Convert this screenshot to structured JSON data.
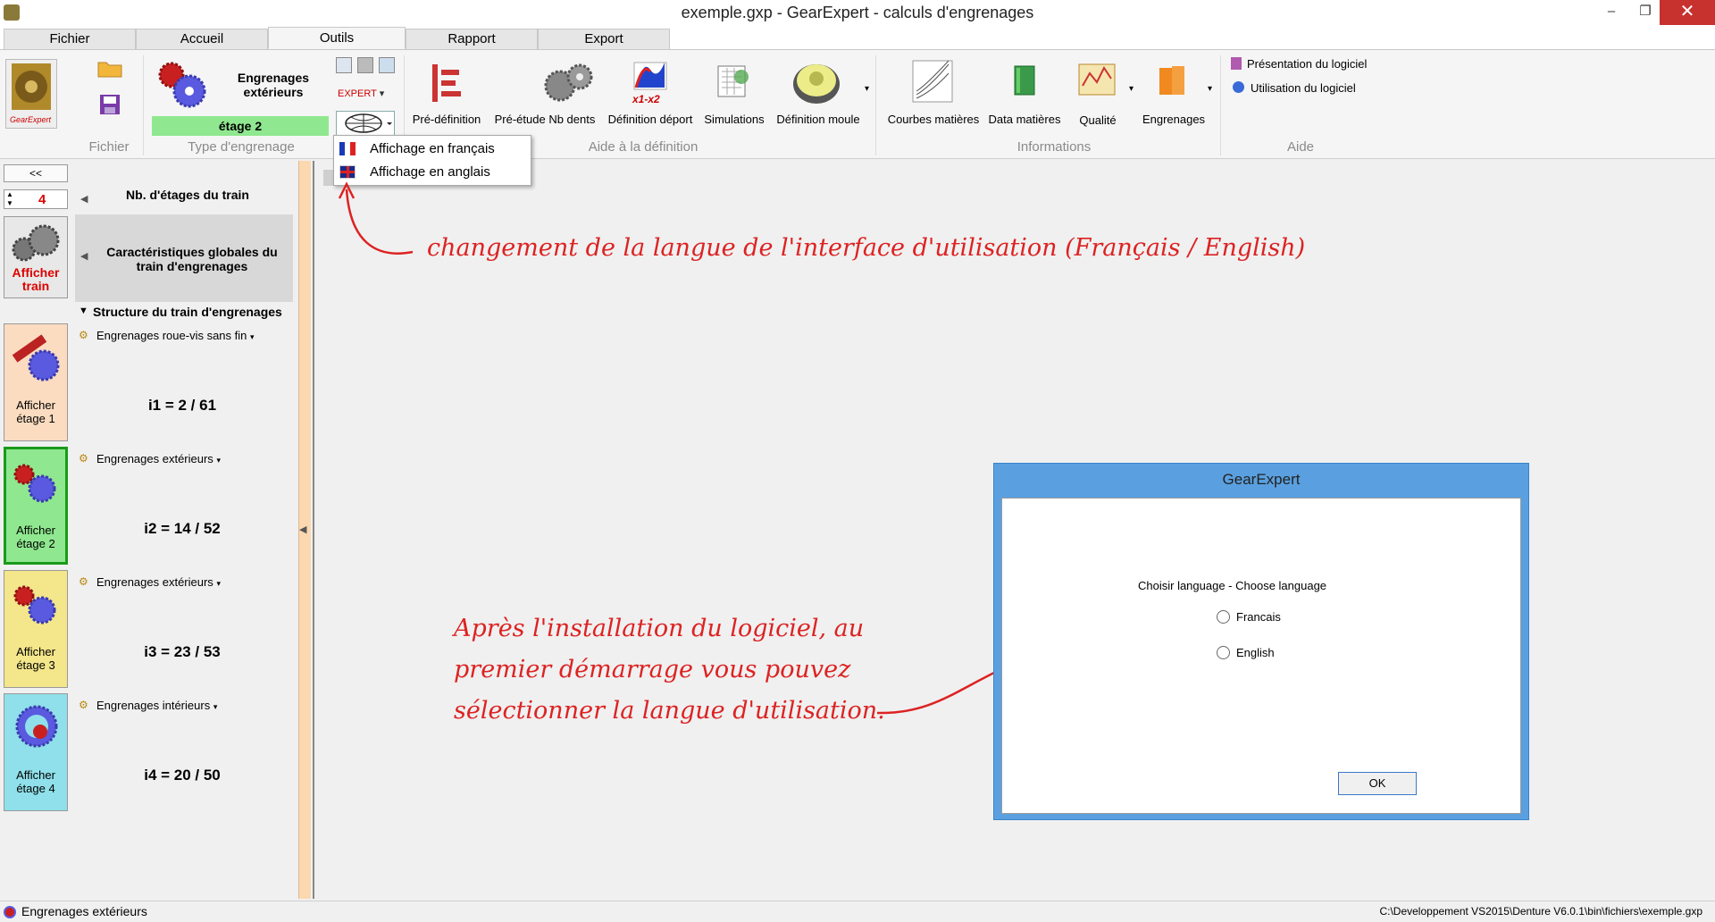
{
  "window": {
    "title": "exemple.gxp - GearExpert - calculs d'engrenages",
    "min": "–",
    "max": "❐",
    "close": "✕"
  },
  "tabs": [
    "Fichier",
    "Accueil",
    "Outils",
    "Rapport",
    "Export"
  ],
  "ribbon": {
    "type_label": "Engrenages extérieurs",
    "stage_label": "étage 2",
    "expert": "EXPERT",
    "buttons": {
      "predef": "Pré-définition",
      "preetude": "Pré-étude Nb dents",
      "deport": "Définition déport",
      "simulations": "Simulations",
      "moule": "Définition moule",
      "courbes": "Courbes matières",
      "data": "Data matières",
      "qualite": "Qualité",
      "engrenages": "Engrenages",
      "presentation": "Présentation du logiciel",
      "utilisation": "Utilisation du logiciel",
      "x1x2": "x1-x2",
      "logo": "GearExpert"
    },
    "groups": {
      "fichier": "Fichier",
      "type": "Type d'engrenage",
      "aide_def": "Aide à la définition",
      "infos": "Informations",
      "aide": "Aide"
    }
  },
  "menu": {
    "fr": "Affichage en français",
    "en": "Affichage en anglais"
  },
  "left": {
    "collapse": "<<",
    "stages_count": "4",
    "nb_etages": "Nb. d'étages du train",
    "afficher_train": "Afficher train",
    "global": "Caractéristiques globales du train d'engrenages",
    "structure": "Structure du train d'engrenages",
    "stages": [
      {
        "type": "Engrenages roue-vis sans fin",
        "ratio": "i1 = 2 / 61",
        "btn": "Afficher étage 1"
      },
      {
        "type": "Engrenages extérieurs",
        "ratio": "i2 = 14 / 52",
        "btn": "Afficher étage 2"
      },
      {
        "type": "Engrenages extérieurs",
        "ratio": "i3 = 23 / 53",
        "btn": "Afficher étage 3"
      },
      {
        "type": "Engrenages intérieurs",
        "ratio": "i4 = 20 / 50",
        "btn": "Afficher étage 4"
      }
    ]
  },
  "annotations": {
    "lang": "changement de la langue de l'interface d'utilisation (Français / English)",
    "install": [
      "Après l'installation du logiciel, au",
      "premier démarrage vous pouvez",
      "sélectionner la langue d'utilisation."
    ]
  },
  "dialog": {
    "title": "GearExpert",
    "prompt": "Choisir language - Choose language",
    "opt_fr": "Francais",
    "opt_en": "English",
    "ok": "OK"
  },
  "status": {
    "left": "Engrenages extérieurs",
    "right": "C:\\Developpement VS2015\\Denture V6.0.1\\bin\\fichiers\\exemple.gxp"
  },
  "colors": {
    "stage1": "#fbdcc0",
    "stage2": "#8fe88f",
    "stage3": "#f4e68a",
    "stage4": "#8fe0ea",
    "accent": "#d22"
  }
}
